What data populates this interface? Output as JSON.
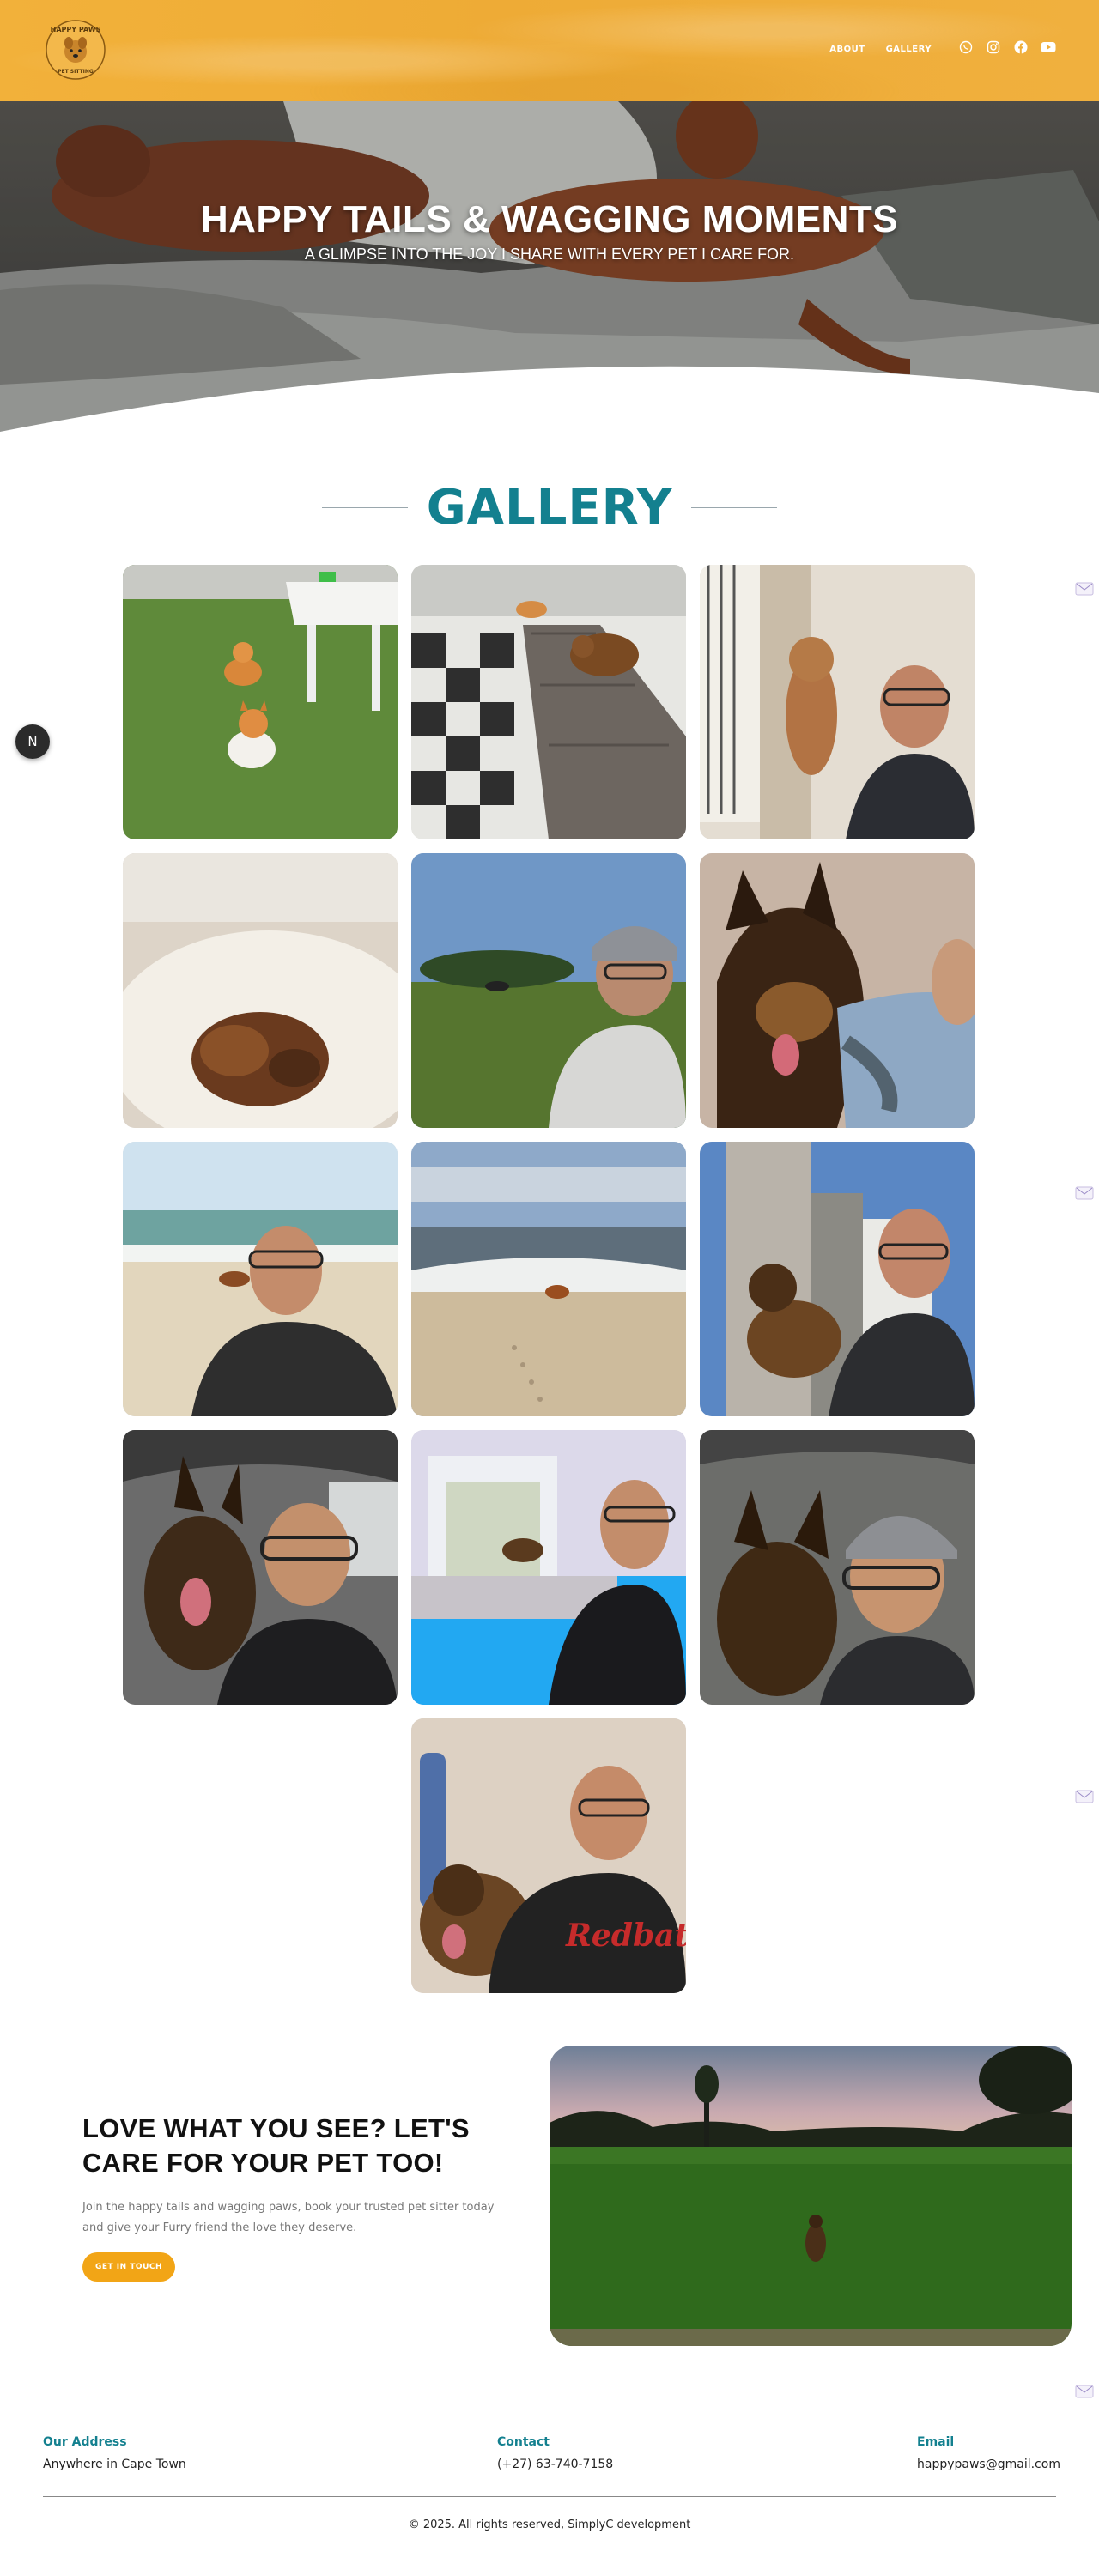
{
  "brand": {
    "logo_text": "HAPPY PAWS",
    "logo_subtext": "PET SITTING"
  },
  "nav": {
    "items": [
      "ABOUT",
      "GALLERY"
    ]
  },
  "social": [
    "whatsapp-icon",
    "instagram-icon",
    "facebook-icon",
    "youtube-icon"
  ],
  "hero": {
    "title": "HAPPY TAILS & WAGGING MOMENTS",
    "subtitle": "A GLIMPSE INTO THE JOY I SHARE WITH EVERY PET I CARE FOR."
  },
  "gallery": {
    "heading": "GALLERY",
    "photos": [
      "corgis-on-grass-photo",
      "cat-on-wooden-bench-photo",
      "dog-and-sitter-photo",
      "sleeping-cat-photo",
      "park-selfie-photo",
      "german-shepherd-close-photo",
      "beach-selfie-photo",
      "beach-dog-photo",
      "shepherd-outdoor-selfie-photo",
      "car-selfie-shepherd-photo",
      "pool-selfie-photo",
      "car-selfie-beanie-photo",
      "shepherd-home-selfie-photo"
    ]
  },
  "side_widget": {
    "label": "N"
  },
  "cta": {
    "title": "LOVE WHAT YOU SEE? LET'S CARE FOR YOUR PET TOO!",
    "text": "Join the happy tails and wagging paws, book your trusted pet sitter today and give your Furry friend the love they deserve.",
    "button": "GET IN TOUCH"
  },
  "footer": {
    "address_label": "Our Address",
    "address": "Anywhere in Cape Town",
    "contact_label": "Contact",
    "contact": "(+27) 63-740-7158",
    "email_label": "Email",
    "email": "happypaws@gmail.com",
    "copyright": "© 2025. All rights reserved, SimplyC development"
  },
  "colors": {
    "header": "#f0ae38",
    "teal": "#13808f",
    "button": "#f2a516"
  }
}
